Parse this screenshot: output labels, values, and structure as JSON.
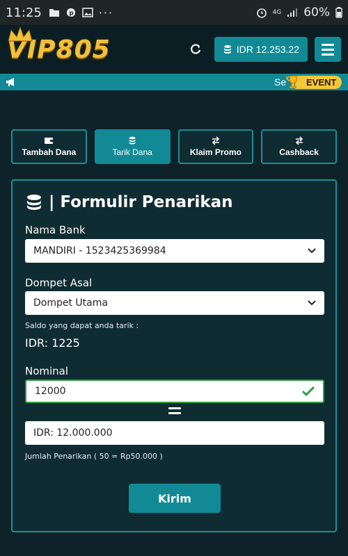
{
  "statusbar": {
    "time": "11:25",
    "battery": "60%",
    "network": "4G"
  },
  "header": {
    "logo": "VIP805",
    "balance": "IDR 12.253.22"
  },
  "marquee": {
    "text": "Se",
    "event_label": "EVENT"
  },
  "tabs": [
    {
      "label": "Tambah Dana",
      "icon": "wallet-icon",
      "active": false
    },
    {
      "label": "Tarik Dana",
      "icon": "coins-icon",
      "active": true
    },
    {
      "label": "Klaim Promo",
      "icon": "exchange-icon",
      "active": false
    },
    {
      "label": "Cashback",
      "icon": "exchange-icon",
      "active": false
    }
  ],
  "form": {
    "title": "| Formulir Penarikan",
    "bank_label": "Nama Bank",
    "bank_value": "MANDIRI - 1523425369984",
    "wallet_label": "Dompet Asal",
    "wallet_value": "Dompet Utama",
    "saldo_note": "Saldo yang dapat anda tarik :",
    "saldo_value": "IDR: 1225",
    "nominal_label": "Nominal",
    "nominal_value": "12000",
    "converted_value": "IDR: 12.000.000",
    "note": "Jumlah Penarikan ( 50 = Rp50.000 )",
    "submit_label": "Kirim"
  },
  "colors": {
    "accent": "#128a96",
    "background": "#0e2229",
    "gold": "#f2c03a",
    "valid": "#2e9e3e"
  }
}
